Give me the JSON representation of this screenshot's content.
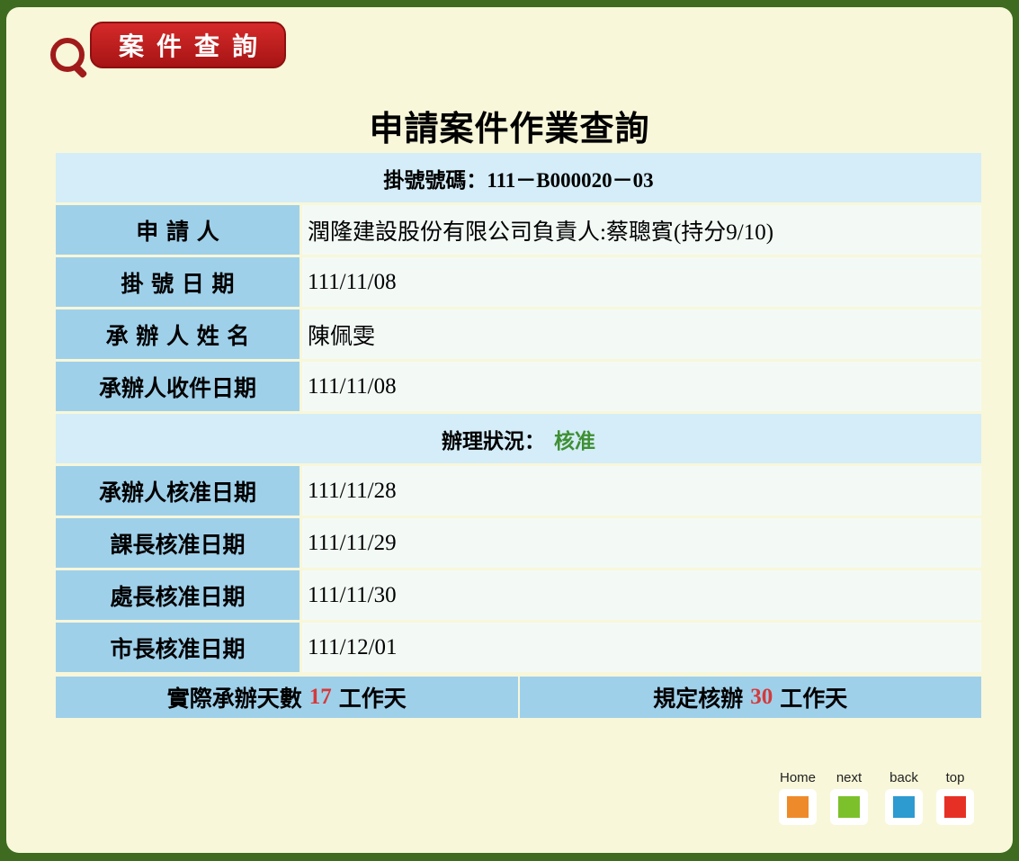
{
  "header": {
    "logo_text": "案件查詢"
  },
  "page_title": "申請案件作業查詢",
  "registration": {
    "label": "掛號號碼：",
    "number": "111－B000020－03"
  },
  "rows_top": [
    {
      "label": "申 請 人",
      "value": "潤隆建設股份有限公司負責人:蔡聰賓(持分9/10)"
    },
    {
      "label": "掛 號 日 期",
      "value": "111/11/08"
    },
    {
      "label": "承 辦 人 姓 名",
      "value": "陳佩雯"
    },
    {
      "label": "承辦人收件日期",
      "value": "111/11/08"
    }
  ],
  "status": {
    "label": "辦理狀況：",
    "value": "核准"
  },
  "rows_bottom": [
    {
      "label": "承辦人核准日期",
      "value": "111/11/28"
    },
    {
      "label": "課長核准日期",
      "value": "111/11/29"
    },
    {
      "label": "處長核准日期",
      "value": "111/11/30"
    },
    {
      "label": "市長核准日期",
      "value": "111/12/01"
    }
  ],
  "footer": {
    "actual": {
      "prefix": "實際承辦天數",
      "days": "17",
      "suffix": "工作天"
    },
    "required": {
      "prefix": "規定核辦",
      "days": "30",
      "suffix": "工作天"
    }
  },
  "nav": [
    {
      "label": "Home",
      "color": "#ef8a2a",
      "icon": "home-icon"
    },
    {
      "label": "next",
      "color": "#7cc12c",
      "icon": "next-icon"
    },
    {
      "label": "back",
      "color": "#2d9ad0",
      "icon": "back-icon"
    },
    {
      "label": "top",
      "color": "#e73025",
      "icon": "top-icon"
    }
  ]
}
